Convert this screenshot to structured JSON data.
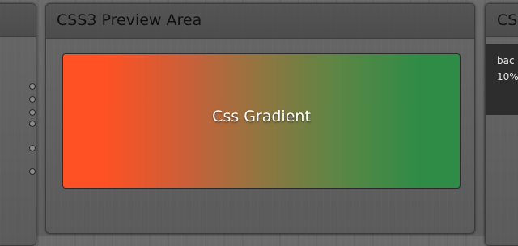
{
  "preview_panel": {
    "title": "CSS3 Preview Area",
    "preview_label": "Css Gradient",
    "gradient_colors": [
      "#ff5123",
      "#2e8c46"
    ]
  },
  "code_panel": {
    "title_visible": "CS",
    "code_lines": [
      "bac",
      "10%"
    ]
  },
  "left_panel": {
    "radio_count": 6
  }
}
